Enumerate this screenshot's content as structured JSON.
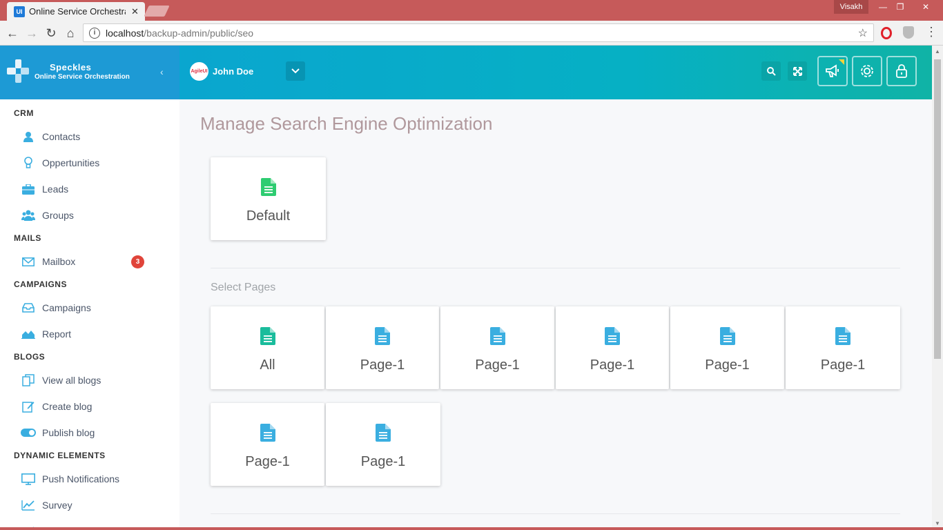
{
  "browser": {
    "tab_title": "Online Service Orchestration",
    "tab_favicon": "UI",
    "window_user": "Visakh",
    "url_host": "localhost",
    "url_path": "/backup-admin/public/seo"
  },
  "brand": {
    "name": "Speckles",
    "subtitle": "Online Service Orchestration"
  },
  "user": {
    "name": "John Doe",
    "avatar_text": "AgileUI"
  },
  "sidebar": {
    "sections": [
      {
        "title": "CRM"
      },
      {
        "title": "MAILS"
      },
      {
        "title": "CAMPAIGNS"
      },
      {
        "title": "BLOGS"
      },
      {
        "title": "DYNAMIC ELEMENTS"
      }
    ],
    "items": [
      {
        "label": "Contacts",
        "icon": "user-icon"
      },
      {
        "label": "Oppertunities",
        "icon": "lightbulb-icon"
      },
      {
        "label": "Leads",
        "icon": "briefcase-icon"
      },
      {
        "label": "Groups",
        "icon": "users-icon"
      },
      {
        "label": "Mailbox",
        "icon": "envelope-icon",
        "badge": "3"
      },
      {
        "label": "Campaigns",
        "icon": "inbox-icon"
      },
      {
        "label": "Report",
        "icon": "area-chart-icon"
      },
      {
        "label": "View all blogs",
        "icon": "copy-icon"
      },
      {
        "label": "Create blog",
        "icon": "edit-icon"
      },
      {
        "label": "Publish blog",
        "icon": "toggle-icon"
      },
      {
        "label": "Push Notifications",
        "icon": "monitor-icon"
      },
      {
        "label": "Survey",
        "icon": "line-chart-icon"
      }
    ]
  },
  "main": {
    "title": "Manage Search Engine Optimization",
    "default_card": {
      "label": "Default"
    },
    "select_pages_label": "Select Pages",
    "pages": [
      {
        "label": "All"
      },
      {
        "label": "Page-1"
      },
      {
        "label": "Page-1"
      },
      {
        "label": "Page-1"
      },
      {
        "label": "Page-1"
      },
      {
        "label": "Page-1"
      },
      {
        "label": "Page-1"
      },
      {
        "label": "Page-1"
      }
    ]
  },
  "colors": {
    "brand_blue": "#1d9ad5",
    "doc_green": "#2ecc71",
    "doc_teal": "#1abc9c",
    "doc_blue": "#3aaee0",
    "badge_red": "#e0443a"
  }
}
